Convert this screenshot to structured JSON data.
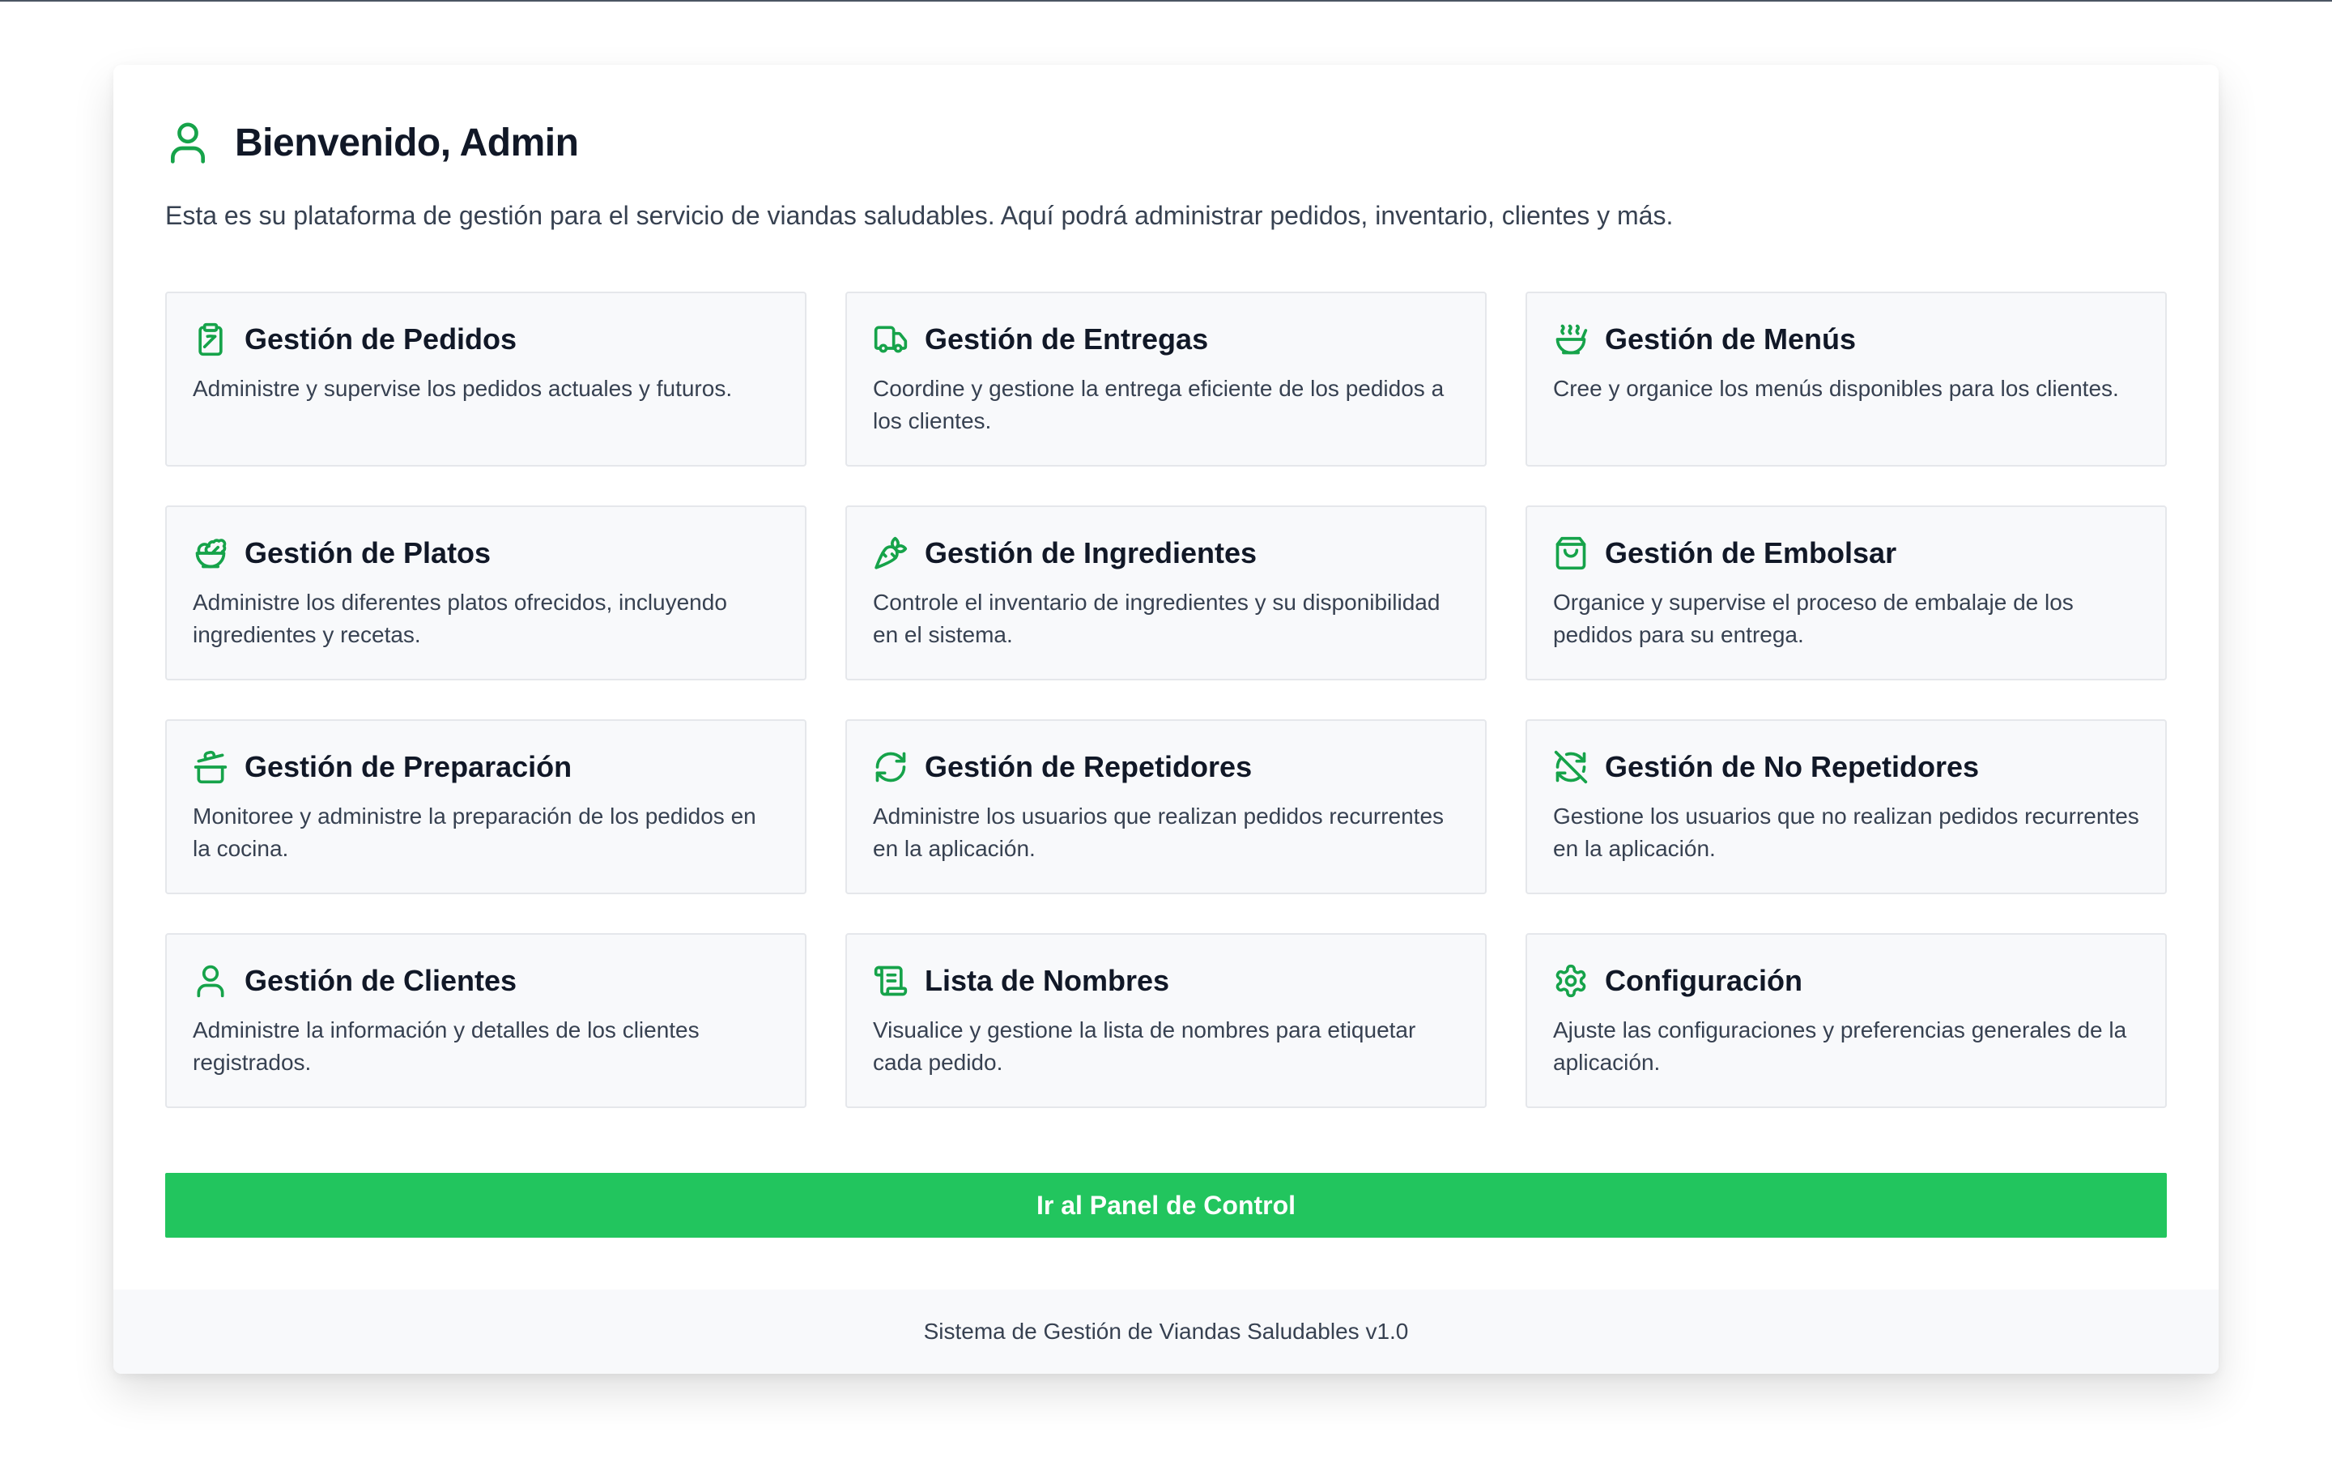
{
  "header": {
    "title": "Bienvenido, Admin",
    "icon": "user-icon"
  },
  "intro": "Esta es su plataforma de gestión para el servicio de viandas saludables. Aquí podrá administrar pedidos, inventario, clientes y más.",
  "cards": [
    {
      "icon": "clipboard-icon",
      "title": "Gestión de Pedidos",
      "description": "Administre y supervise los pedidos actuales y futuros."
    },
    {
      "icon": "truck-icon",
      "title": "Gestión de Entregas",
      "description": "Coordine y gestione la entrega eficiente de los pedidos a los clientes."
    },
    {
      "icon": "soup-icon",
      "title": "Gestión de Menús",
      "description": "Cree y organice los menús disponibles para los clientes."
    },
    {
      "icon": "salad-icon",
      "title": "Gestión de Platos",
      "description": "Administre los diferentes platos ofrecidos, incluyendo ingredientes y recetas."
    },
    {
      "icon": "carrot-icon",
      "title": "Gestión de Ingredientes",
      "description": "Controle el inventario de ingredientes y su disponibilidad en el sistema."
    },
    {
      "icon": "shopping-bag-icon",
      "title": "Gestión de Embolsar",
      "description": "Organice y supervise el proceso de embalaje de los pedidos para su entrega."
    },
    {
      "icon": "cooking-pot-icon",
      "title": "Gestión de Preparación",
      "description": "Monitoree y administre la preparación de los pedidos en la cocina."
    },
    {
      "icon": "refresh-icon",
      "title": "Gestión de Repetidores",
      "description": "Administre los usuarios que realizan pedidos recurrentes en la aplicación."
    },
    {
      "icon": "refresh-off-icon",
      "title": "Gestión de No Repetidores",
      "description": "Gestione los usuarios que no realizan pedidos recurrentes en la aplicación."
    },
    {
      "icon": "user-icon",
      "title": "Gestión de Clientes",
      "description": "Administre la información y detalles de los clientes registrados."
    },
    {
      "icon": "scroll-text-icon",
      "title": "Lista de Nombres",
      "description": "Visualice y gestione la lista de nombres para etiquetar cada pedido."
    },
    {
      "icon": "settings-icon",
      "title": "Configuración",
      "description": "Ajuste las configuraciones y preferencias generales de la aplicación."
    }
  ],
  "cta_label": "Ir al Panel de Control",
  "footer": "Sistema de Gestión de Viandas Saludables v1.0",
  "colors": {
    "accent": "#22c55e",
    "icon": "#16a34a",
    "card_bg": "#f8f9fb",
    "card_border": "#e5e7eb",
    "text": "#111827",
    "muted_text": "#374151"
  }
}
